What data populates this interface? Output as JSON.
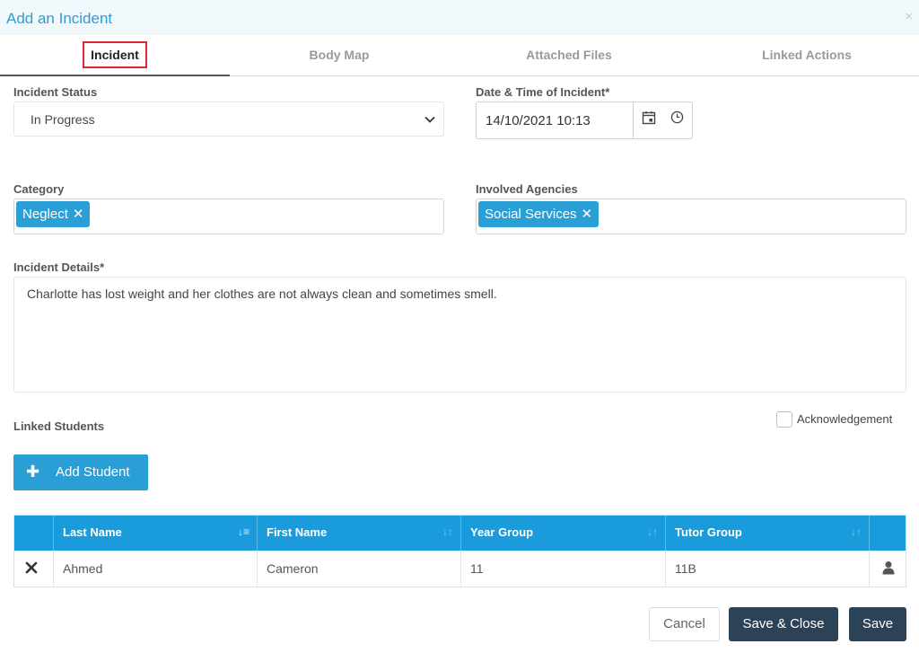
{
  "dialog": {
    "title": "Add an Incident",
    "close_glyph": "×"
  },
  "tabs": [
    {
      "label": "Incident"
    },
    {
      "label": "Body Map"
    },
    {
      "label": "Attached Files"
    },
    {
      "label": "Linked Actions"
    }
  ],
  "form": {
    "incident_status_label": "Incident Status",
    "incident_status_value": "In Progress",
    "datetime_label": "Date & Time of Incident*",
    "datetime_value": "14/10/2021 10:13",
    "category_label": "Category",
    "category_tags": [
      "Neglect"
    ],
    "agencies_label": "Involved Agencies",
    "agencies_tags": [
      "Social Services"
    ],
    "details_label": "Incident Details*",
    "details_value": "Charlotte has lost weight and her clothes are not always clean and sometimes smell.",
    "linked_students_label": "Linked Students",
    "acknowledgement_label": "Acknowledgement",
    "acknowledgement_checked": false
  },
  "add_student": {
    "icon": "plus-icon",
    "label": "Add Student"
  },
  "grid": {
    "headers": [
      "Last Name",
      "First Name",
      "Year Group",
      "Tutor Group"
    ],
    "rows": [
      {
        "last_name": "Ahmed",
        "first_name": "Cameron",
        "year_group": "11",
        "tutor_group": "11B"
      }
    ]
  },
  "footer": {
    "cancel": "Cancel",
    "save_close": "Save & Close",
    "save": "Save"
  },
  "colors": {
    "accent": "#2a9fd6",
    "grid_header": "#1a9bdb",
    "dark_button": "#2c4257",
    "active_tab_outline": "#e0262c"
  }
}
